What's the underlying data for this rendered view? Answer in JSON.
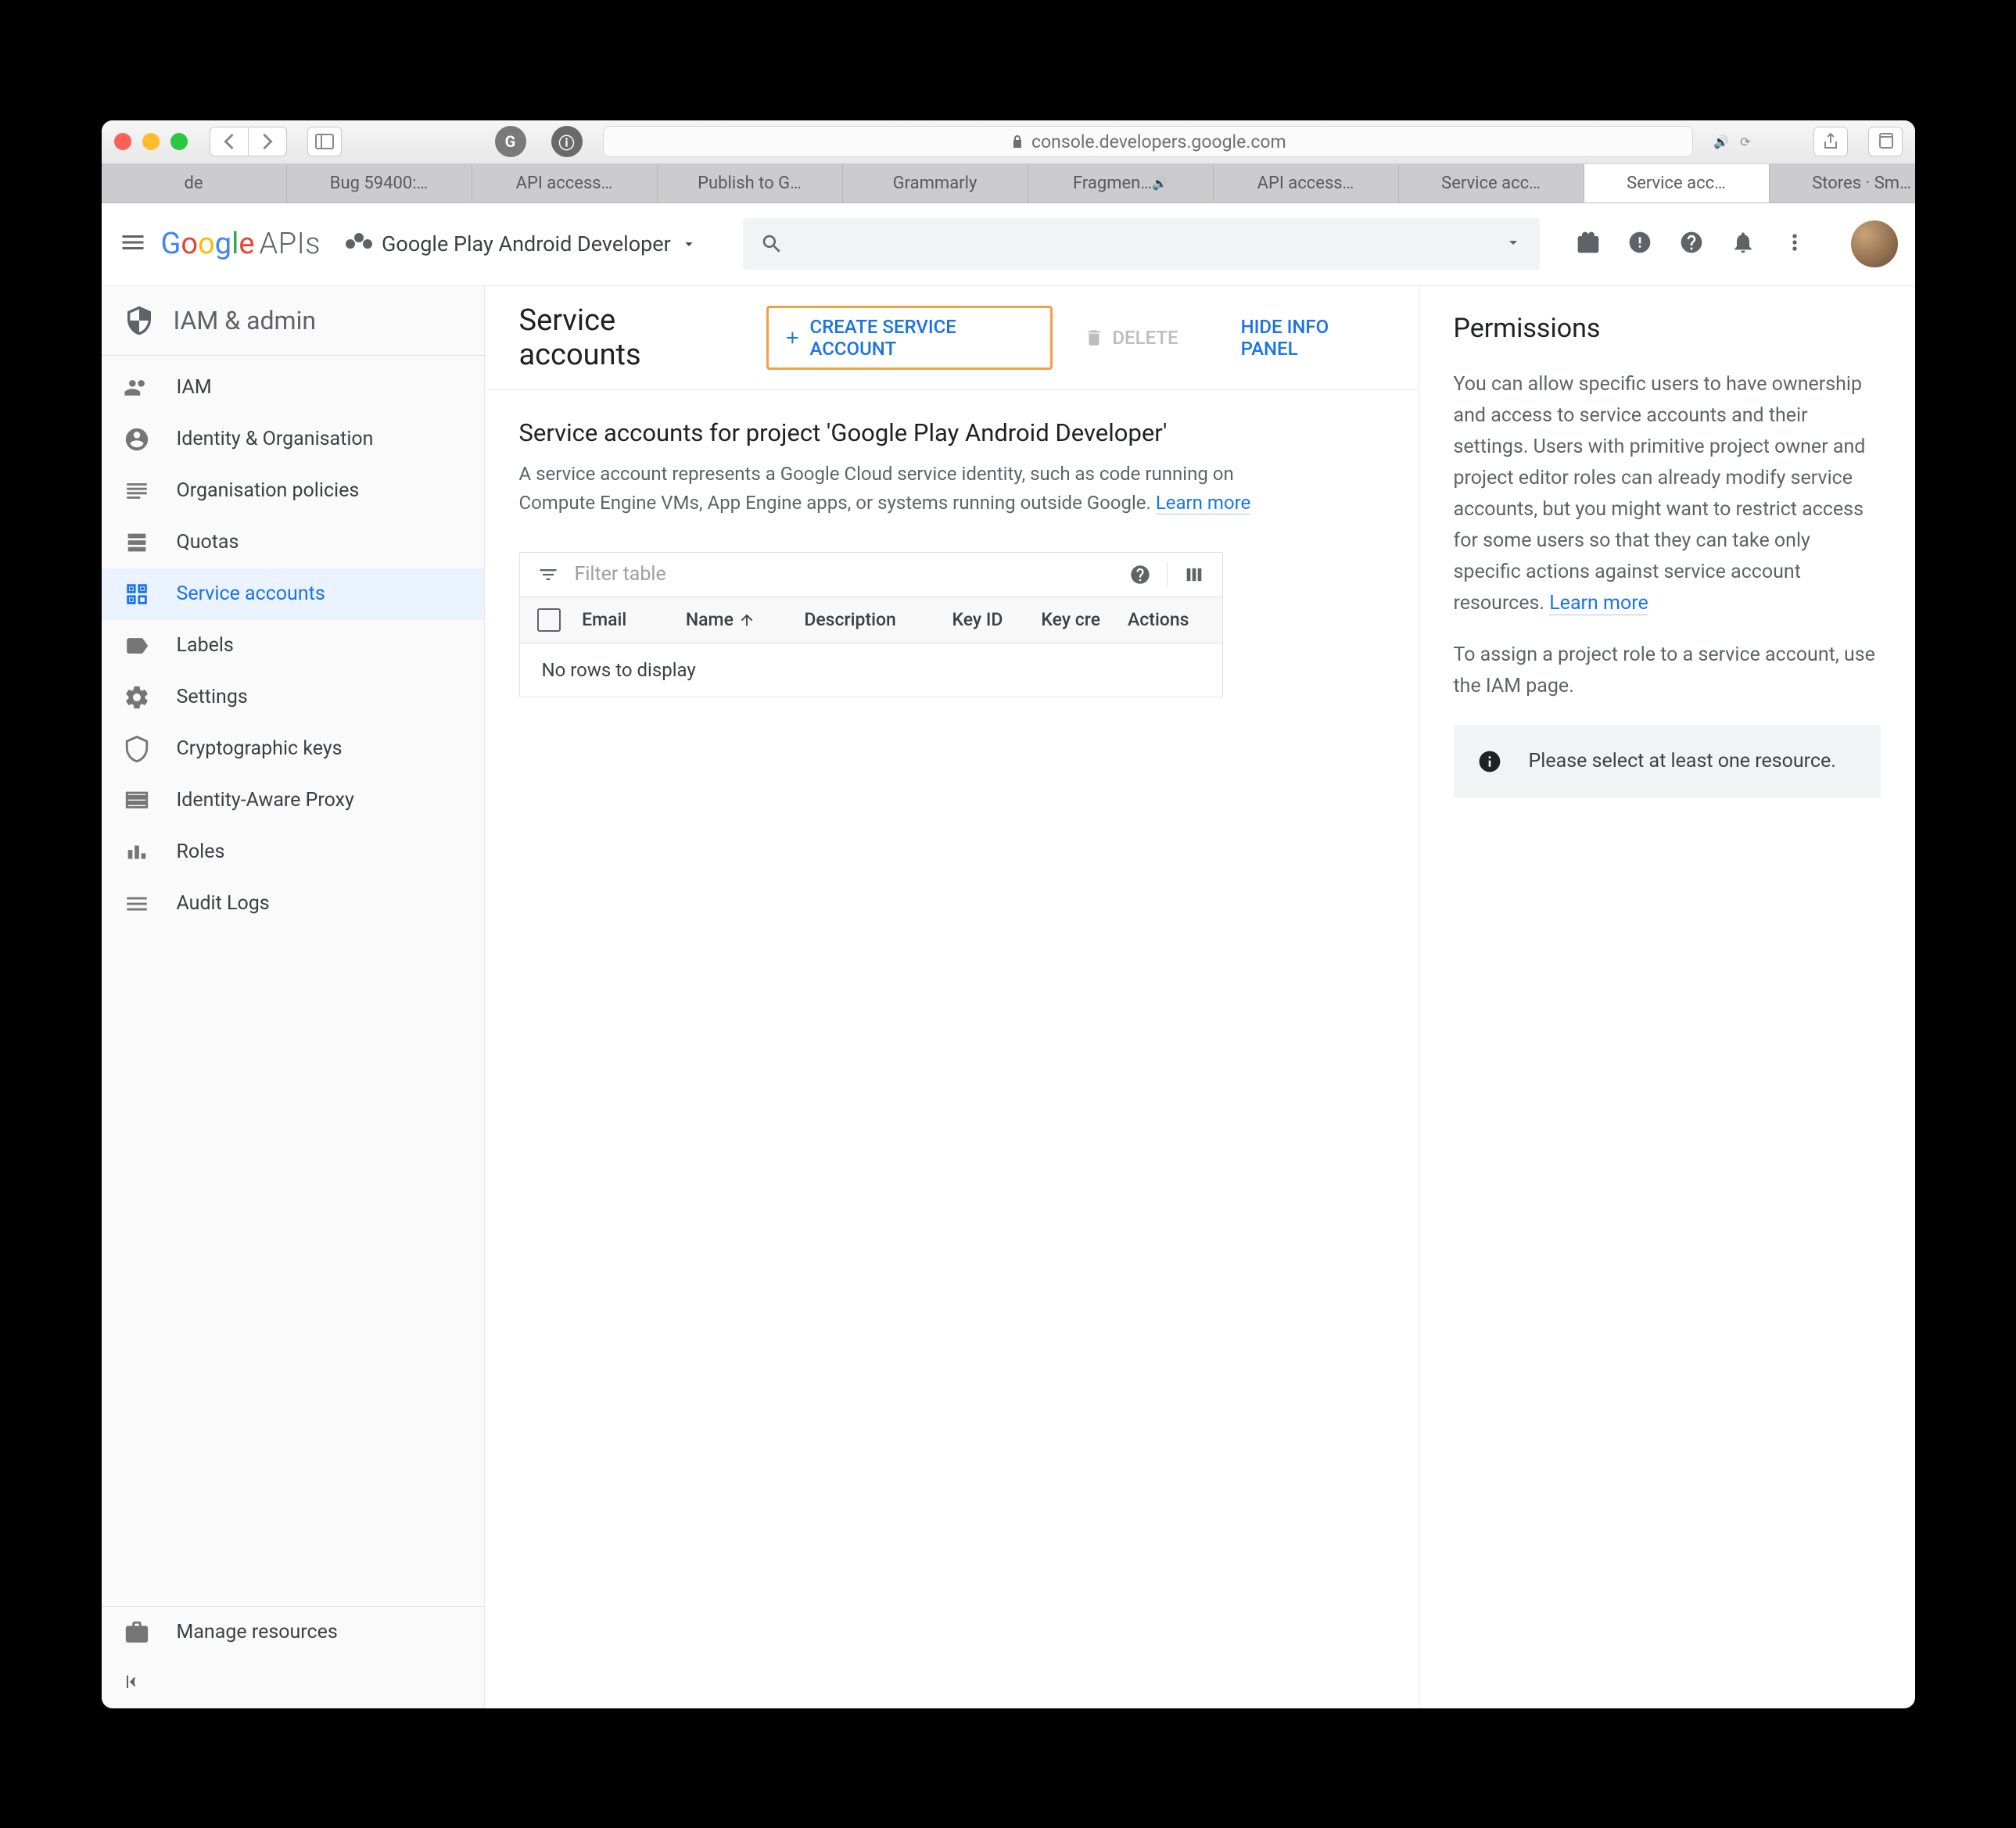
{
  "browser": {
    "url_host": "console.developers.google.com",
    "tabs": [
      "de",
      "Bug 59400:…",
      "API access…",
      "Publish to G…",
      "Grammarly",
      "Fragmen…",
      "API access…",
      "Service acc…",
      "Service acc…",
      "Stores · Sm…"
    ],
    "active_tab_index": 8
  },
  "header": {
    "brand_apis": "APIs",
    "project_name": "Google Play Android Developer"
  },
  "sidebar": {
    "section_title": "IAM & admin",
    "items": [
      {
        "label": "IAM"
      },
      {
        "label": "Identity & Organisation"
      },
      {
        "label": "Organisation policies"
      },
      {
        "label": "Quotas"
      },
      {
        "label": "Service accounts"
      },
      {
        "label": "Labels"
      },
      {
        "label": "Settings"
      },
      {
        "label": "Cryptographic keys"
      },
      {
        "label": "Identity-Aware Proxy"
      },
      {
        "label": "Roles"
      },
      {
        "label": "Audit Logs"
      }
    ],
    "active_index": 4,
    "footer": "Manage resources"
  },
  "content": {
    "header_title": "Service accounts",
    "create_label": "CREATE SERVICE ACCOUNT",
    "delete_label": "DELETE",
    "hide_panel_label": "HIDE INFO PANEL",
    "subtitle": "Service accounts for project 'Google Play Android Developer'",
    "description": "A service account represents a Google Cloud service identity, such as code running on Compute Engine VMs, App Engine apps, or systems running outside Google. ",
    "learn_more": "Learn more",
    "table": {
      "filter_placeholder": "Filter table",
      "columns": [
        "Email",
        "Name",
        "Description",
        "Key ID",
        "Key cre",
        "Actions"
      ],
      "empty": "No rows to display"
    }
  },
  "panel": {
    "title": "Permissions",
    "text1": "You can allow specific users to have ownership and access to service accounts and their settings. Users with primitive project owner and project editor roles can already modify service accounts, but you might want to restrict access for some users so that they can take only specific actions against service account resources. ",
    "learn_more": "Learn more",
    "text2": "To assign a project role to a service account, use the IAM page.",
    "notice": "Please select at least one resource."
  }
}
